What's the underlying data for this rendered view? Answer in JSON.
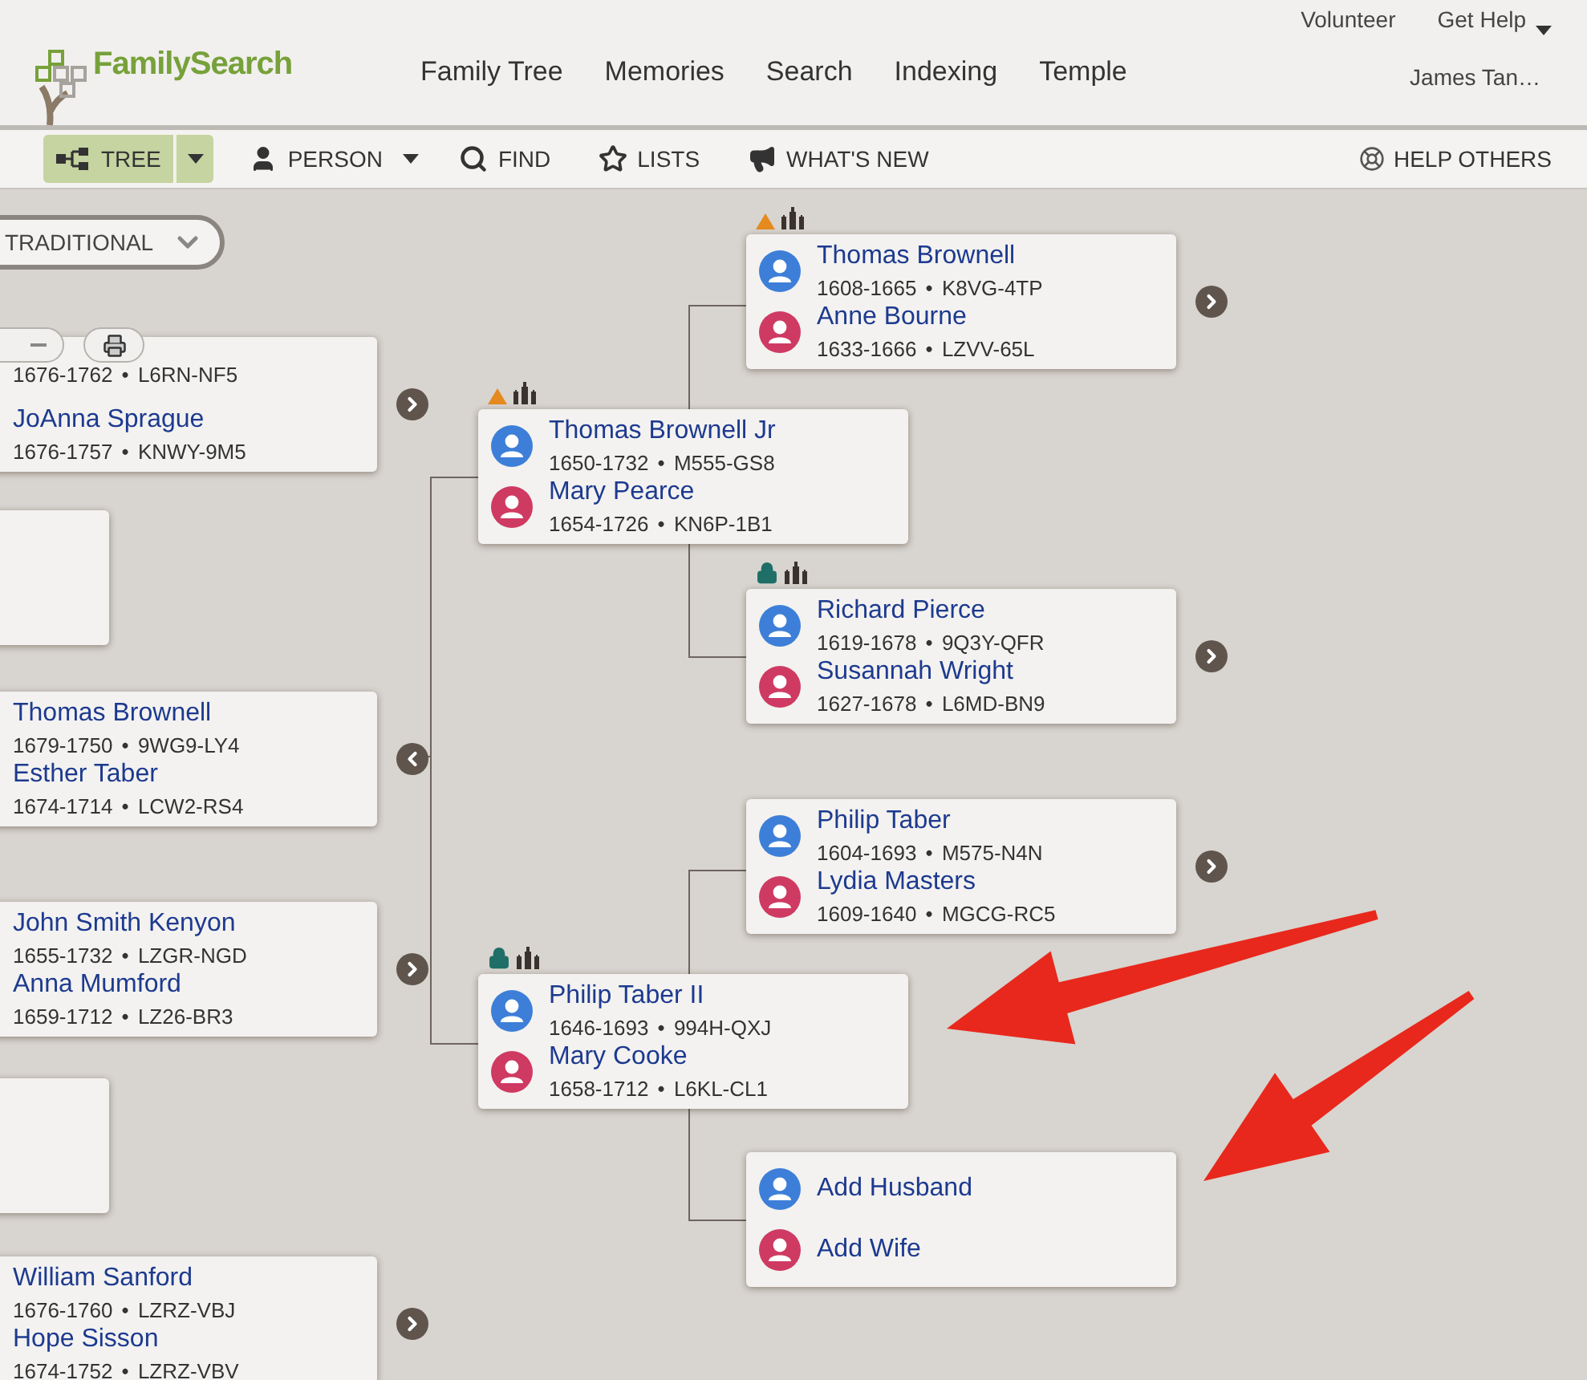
{
  "header": {
    "logo": "FamilySearch",
    "nav": [
      {
        "label": "Family Tree"
      },
      {
        "label": "Memories"
      },
      {
        "label": "Search"
      },
      {
        "label": "Indexing"
      },
      {
        "label": "Temple"
      }
    ],
    "top_links": [
      {
        "label": "Volunteer",
        "dropdown": false
      },
      {
        "label": "Get Help",
        "dropdown": true
      }
    ],
    "user": "James Tan…"
  },
  "toolbar": {
    "items": [
      {
        "label": "TREE",
        "kind": "tree",
        "selected": true,
        "dropdown": true
      },
      {
        "label": "PERSON",
        "kind": "person",
        "selected": false,
        "dropdown": true
      },
      {
        "label": "FIND",
        "kind": "find",
        "selected": false,
        "dropdown": false
      },
      {
        "label": "LISTS",
        "kind": "lists",
        "selected": false,
        "dropdown": false
      },
      {
        "label": "WHAT'S NEW",
        "kind": "news",
        "selected": false,
        "dropdown": false
      }
    ],
    "help": "HELP OTHERS"
  },
  "view_selector": "TRADITIONAL",
  "generations": [
    {
      "couples": [
        {
          "kind": "couple",
          "husband": {
            "vitals": "1676-1762 • L6RN-NF5"
          },
          "wife": {
            "name": "JoAnna Sprague",
            "vitals": "1676-1757 • KNWY-9M5"
          },
          "nav_button": {
            "kind": "expand"
          }
        },
        {
          "kind": "empty"
        },
        {
          "kind": "couple",
          "husband": {
            "name": "Thomas Brownell",
            "vitals": "1679-1750 • 9WG9-LY4"
          },
          "wife": {
            "name": "Esther Taber",
            "vitals": "1674-1714 • LCW2-RS4"
          },
          "nav_button": {
            "kind": "collapse"
          }
        },
        {
          "kind": "couple",
          "husband": {
            "name": "John Smith Kenyon",
            "vitals": "1655-1732 • LZGR-NGD"
          },
          "wife": {
            "name": "Anna Mumford",
            "vitals": "1659-1712 • LZ26-BR3"
          },
          "nav_button": {
            "kind": "expand"
          }
        },
        {
          "kind": "empty"
        },
        {
          "kind": "couple",
          "husband": {
            "name": "William Sanford",
            "vitals": "1676-1760 • LZRZ-VBJ"
          },
          "wife": {
            "name": "Hope Sisson",
            "vitals": "1674-1752 • LZRZ-VBV"
          },
          "nav_button": {
            "kind": "expand"
          }
        }
      ]
    },
    {
      "couples": [
        {
          "kind": "couple",
          "husband": {
            "name": "Thomas Brownell Jr",
            "vitals": "1650-1732 • M555-GS8"
          },
          "wife": {
            "name": "Mary Pearce",
            "vitals": "1654-1726 • KN6P-1B1"
          },
          "badges": [
            {
              "kind": "warning"
            },
            {
              "kind": "temple"
            }
          ]
        },
        {
          "kind": "couple",
          "husband": {
            "name": "Philip Taber II",
            "vitals": "1646-1693 • 994H-QXJ"
          },
          "wife": {
            "name": "Mary Cooke",
            "vitals": "1658-1712 • L6KL-CL1"
          },
          "badges": [
            {
              "kind": "lock"
            },
            {
              "kind": "temple"
            }
          ]
        }
      ]
    },
    {
      "couples": [
        {
          "kind": "couple",
          "husband": {
            "name": "Thomas Brownell",
            "vitals": "1608-1665 • K8VG-4TP"
          },
          "wife": {
            "name": "Anne Bourne",
            "vitals": "1633-1666 • LZVV-65L"
          },
          "nav_button": {
            "kind": "expand"
          },
          "badges": [
            {
              "kind": "warning"
            },
            {
              "kind": "temple"
            }
          ]
        },
        {
          "kind": "couple",
          "husband": {
            "name": "Richard Pierce",
            "vitals": "1619-1678 • 9Q3Y-QFR"
          },
          "wife": {
            "name": "Susannah Wright",
            "vitals": "1627-1678 • L6MD-BN9"
          },
          "nav_button": {
            "kind": "expand"
          },
          "badges": [
            {
              "kind": "lock"
            },
            {
              "kind": "temple"
            }
          ]
        },
        {
          "kind": "couple",
          "husband": {
            "name": "Philip Taber",
            "vitals": "1604-1693 • M575-N4N"
          },
          "wife": {
            "name": "Lydia Masters",
            "vitals": "1609-1640 • MGCG-RC5"
          },
          "nav_button": {
            "kind": "expand"
          }
        },
        {
          "kind": "add",
          "husband": {
            "name": "Add Husband"
          },
          "wife": {
            "name": "Add Wife"
          }
        }
      ]
    }
  ]
}
